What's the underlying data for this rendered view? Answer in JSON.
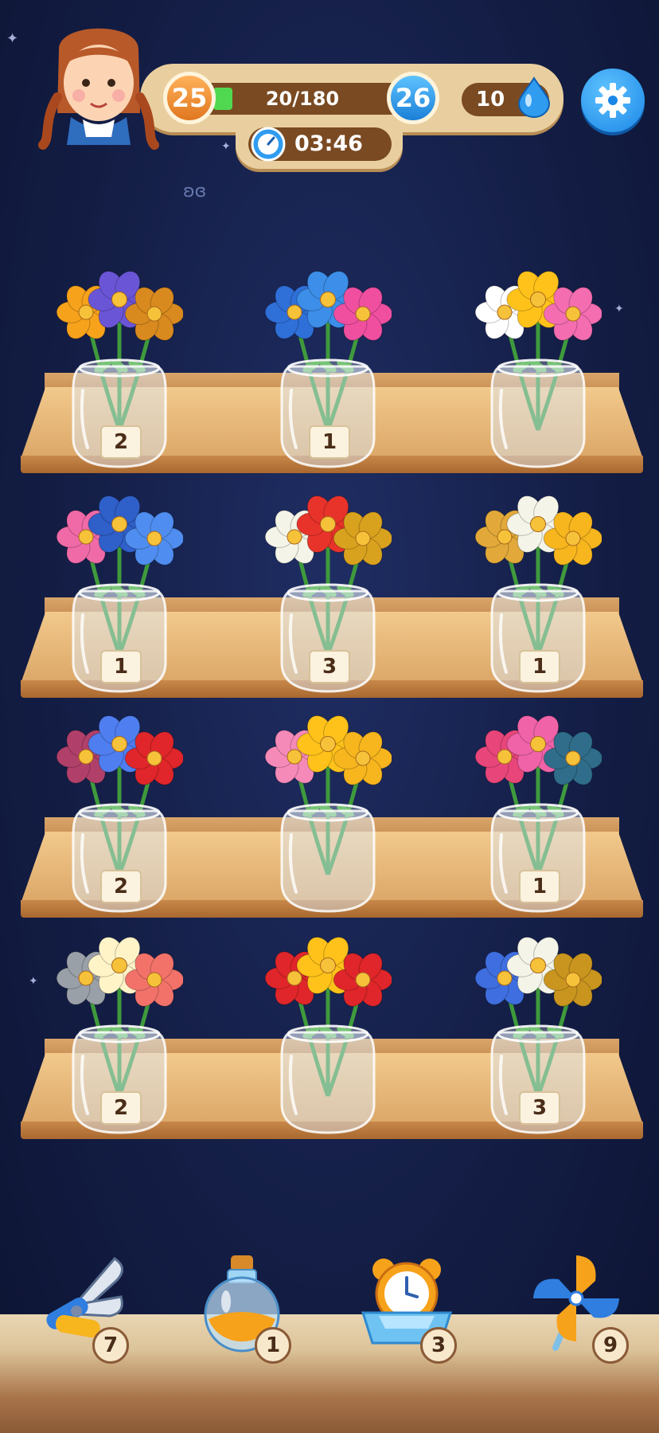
{
  "hud": {
    "level_current": "25",
    "level_next": "26",
    "xp": "20/180",
    "xp_progress": 0.11,
    "drops": "10",
    "timer": "03:46",
    "icons": [
      "avatar-girl",
      "water-drop-icon",
      "stopwatch-icon",
      "gear-icon"
    ]
  },
  "shelves": [
    {
      "jars": [
        {
          "count": "2",
          "flowers": [
            "#f7a21b",
            "#6a55d6",
            "#d98a1e"
          ]
        },
        {
          "count": "1",
          "flowers": [
            "#2f6fd8",
            "#3c8ee8",
            "#f04fa0"
          ]
        },
        {
          "count": "",
          "flowers": [
            "#ffffff",
            "#ffc21a",
            "#f46db0"
          ]
        }
      ]
    },
    {
      "jars": [
        {
          "count": "1",
          "flowers": [
            "#f06aa8",
            "#2f5fc8",
            "#4f8ef0"
          ]
        },
        {
          "count": "3",
          "flowers": [
            "#f4f4e8",
            "#e8332a",
            "#d9a21e"
          ]
        },
        {
          "count": "1",
          "flowers": [
            "#e2a93a",
            "#f4f4e8",
            "#f7b51e"
          ]
        }
      ]
    },
    {
      "jars": [
        {
          "count": "2",
          "flowers": [
            "#b0406a",
            "#4f7ef0",
            "#e0262a"
          ]
        },
        {
          "count": "",
          "flowers": [
            "#f58ab8",
            "#ffc21a",
            "#f7b51e"
          ]
        },
        {
          "count": "1",
          "flowers": [
            "#e8467a",
            "#f063a8",
            "#2f6d8a"
          ]
        }
      ]
    },
    {
      "jars": [
        {
          "count": "2",
          "flowers": [
            "#9aa0a8",
            "#fff4c8",
            "#f2726a"
          ]
        },
        {
          "count": "",
          "flowers": [
            "#e0262a",
            "#ffc21a",
            "#e0262a"
          ]
        },
        {
          "count": "3",
          "flowers": [
            "#3f6ee0",
            "#f4f4e8",
            "#c9951e"
          ]
        }
      ]
    }
  ],
  "tools": [
    {
      "name": "pruning-shears-icon",
      "count": "7"
    },
    {
      "name": "potion-bottle-icon",
      "count": "1"
    },
    {
      "name": "alarm-clock-icon",
      "count": "3"
    },
    {
      "name": "pinwheel-icon",
      "count": "9"
    }
  ]
}
